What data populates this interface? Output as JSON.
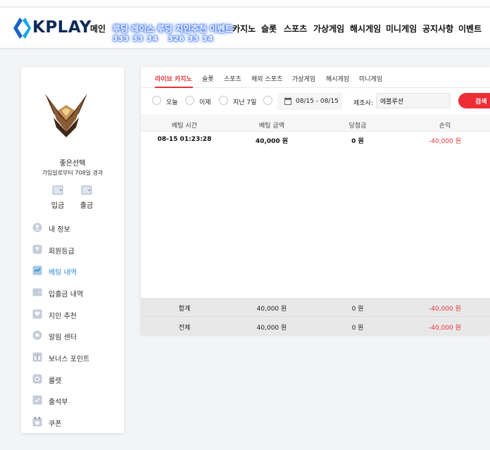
{
  "brand": {
    "name": "KPLAY"
  },
  "nav": {
    "main": "메인",
    "event1": {
      "label": "루딩 레이스",
      "code": "333 33 34"
    },
    "event2": {
      "label": "루딩 지인추천 이벤트",
      "code": "326 33 34"
    },
    "casino": "카지노",
    "slot": "슬롯",
    "sports": "스포츠",
    "virtual": "가상게임",
    "hash": "해시게임",
    "mini": "미니게임",
    "notice": "공지사항",
    "events": "이벤트"
  },
  "user": {
    "name": "좋은선택",
    "joined": "가입일로부터 708일 경과",
    "deposit": "입금",
    "withdraw": "출금"
  },
  "menu": [
    {
      "label": "내 정보",
      "icon": "user-icon",
      "active": false
    },
    {
      "label": "회원등급",
      "icon": "grade-icon",
      "active": false
    },
    {
      "label": "베팅 내역",
      "icon": "bet-history-icon",
      "active": true
    },
    {
      "label": "입출금 내역",
      "icon": "wallet-icon",
      "active": false
    },
    {
      "label": "지인 추천",
      "icon": "referral-icon",
      "active": false
    },
    {
      "label": "알림 센터",
      "icon": "bell-icon",
      "active": false
    },
    {
      "label": "보너스 포인트",
      "icon": "bonus-icon",
      "active": false
    },
    {
      "label": "룰렛",
      "icon": "roulette-icon",
      "active": false
    },
    {
      "label": "출석부",
      "icon": "attendance-icon",
      "active": false
    },
    {
      "label": "쿠폰",
      "icon": "coupon-icon",
      "active": false
    }
  ],
  "tabs": [
    "라이브 카지노",
    "슬롯",
    "스포츠",
    "해외 스포츠",
    "가상게임",
    "해시게임",
    "미니게임"
  ],
  "active_tab": "라이브 카지노",
  "filter": {
    "today": "오늘",
    "yesterday": "이제",
    "last7": "지난 7일",
    "date_range": "08/15 - 08/15",
    "maker_label": "제조사:",
    "maker_value": "에볼루션",
    "search": "검색"
  },
  "table": {
    "headers": [
      "베팅 시간",
      "베팅 금액",
      "당첨금",
      "손익"
    ],
    "rows": [
      {
        "time": "08-15 01:23:28",
        "amount": "40,000 원",
        "win": "0 원",
        "pnl": "-40,000 원"
      }
    ],
    "subtotal": {
      "label": "합계",
      "amount": "40,000 원",
      "win": "0 원",
      "pnl": "-40,000 원"
    },
    "total": {
      "label": "전체",
      "amount": "40,000 원",
      "win": "0 원",
      "pnl": "-40,000 원"
    }
  },
  "colors": {
    "accent_red": "#e5333a",
    "active_blue": "#2e8fd8",
    "brand_navy": "#0e2a57"
  }
}
